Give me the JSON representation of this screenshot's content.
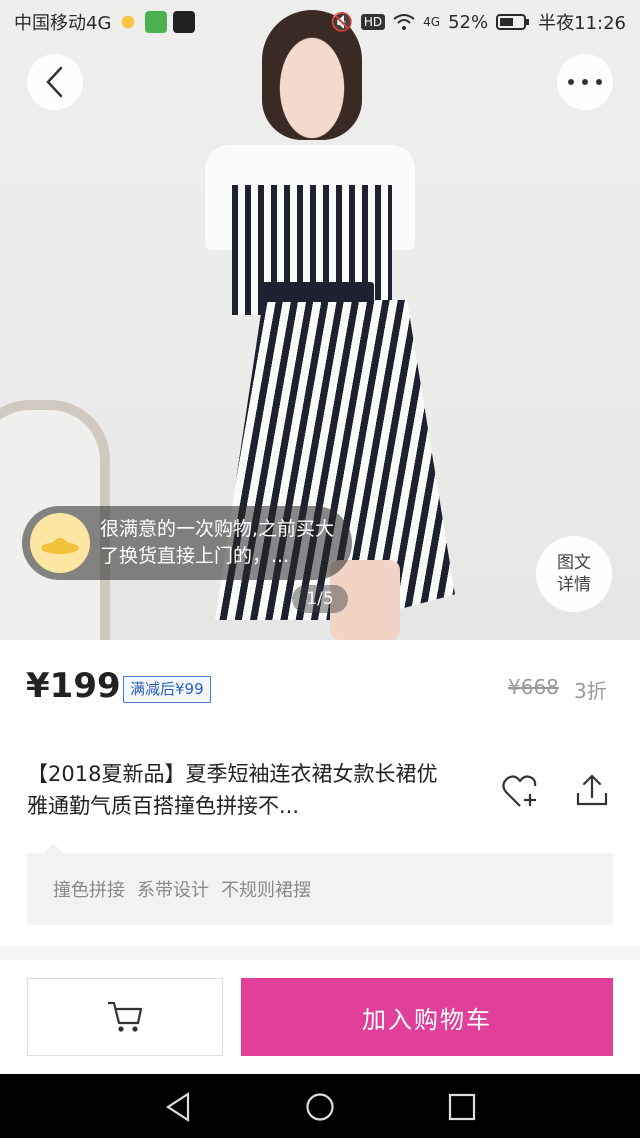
{
  "status_bar": {
    "carrier": "中国移动4G",
    "battery": "52%",
    "time": "半夜11:26",
    "signal": "4G",
    "icons": [
      "weather-icon",
      "app-icon",
      "tiktok-icon",
      "mute-icon",
      "hd-icon",
      "wifi-icon",
      "signal-icon",
      "battery-icon"
    ]
  },
  "hero": {
    "review_text": "很满意的一次购物,之前买大了换货直接上门的，...",
    "indicator": "1/5",
    "detail_line1": "图文",
    "detail_line2": "详情"
  },
  "product": {
    "price": "¥199",
    "promo": "满减后¥99",
    "original_price": "¥668",
    "discount": "3折",
    "title": "【2018夏新品】夏季短袖连衣裙女款长裙优雅通勤气质百搭撞色拼接不...",
    "tags": [
      "撞色拼接",
      "系带设计",
      "不规则裙摆"
    ]
  },
  "actions": {
    "add_to_cart": "加入购物车"
  },
  "colors": {
    "accent": "#e0409a",
    "promo_border": "#4a7bd0"
  }
}
